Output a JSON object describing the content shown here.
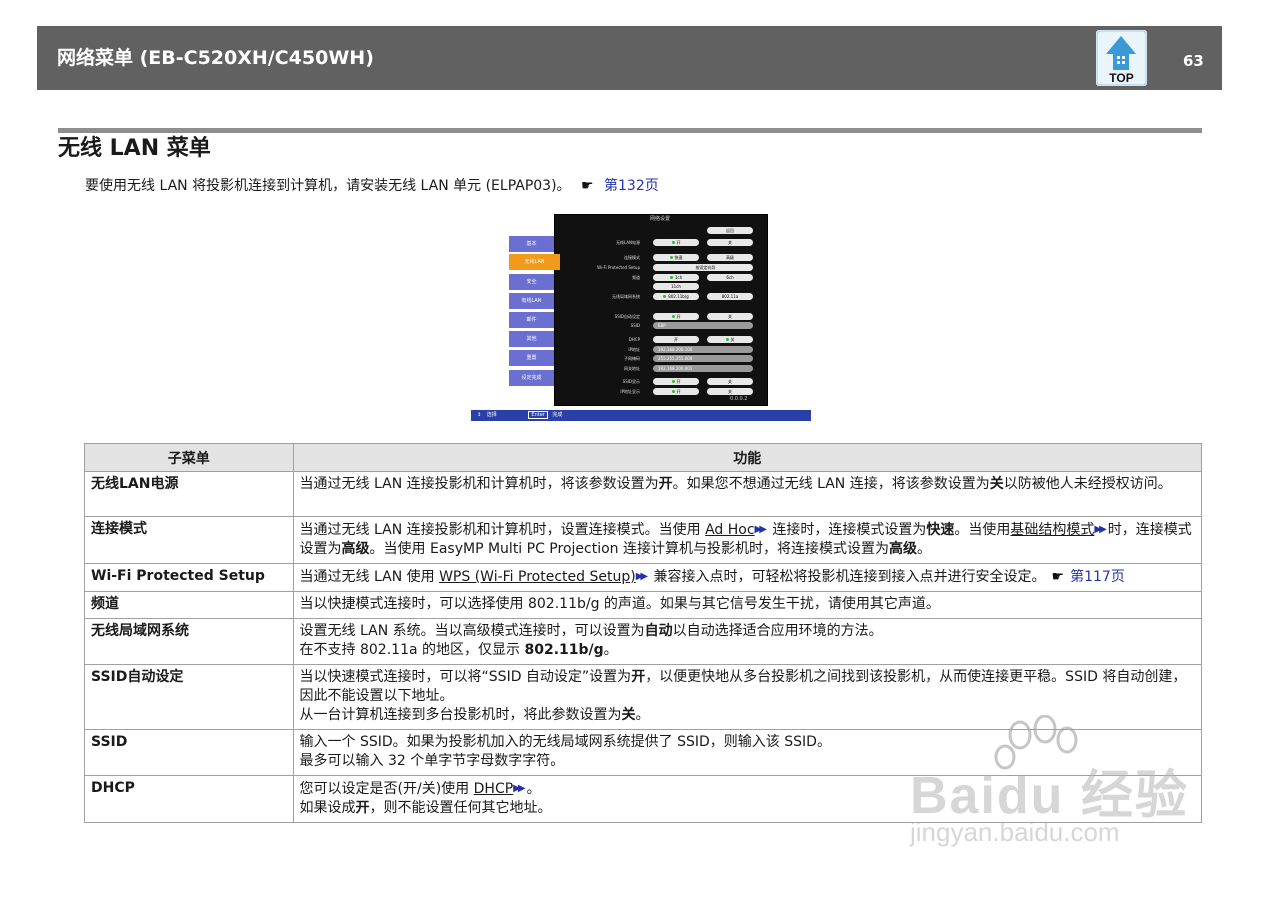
{
  "header": {
    "title": "网络菜单 (EB-C520XH/C450WH)",
    "top_label": "TOP",
    "page_number": "63"
  },
  "section": {
    "title": "无线 LAN 菜单"
  },
  "intro": {
    "text": "要使用无线 LAN 将投影机连接到计算机，请安装无线 LAN 单元 (ELPAP03)。",
    "link": "第132页"
  },
  "screenshot": {
    "title": "网络设置",
    "side_items": [
      "基本",
      "无线LAN",
      "安全",
      "有线LAN",
      "邮件",
      "其他",
      "重置",
      "设定完成"
    ],
    "back": "返回",
    "rows": [
      {
        "label": "无线LAN电源",
        "v1": "开",
        "v2": "关"
      },
      {
        "label": "连接模式",
        "v1": "快速",
        "v2": "高级"
      },
      {
        "label": "Wi-Fi Protected Setup",
        "v1": "按设定向导",
        "v2": ""
      },
      {
        "label": "频道",
        "v1": "1ch",
        "v2": "6ch"
      },
      {
        "label": "",
        "v1": "11ch",
        "v2": ""
      },
      {
        "label": "无线局域网系统",
        "v1": "802.11b/g",
        "v2": "802.11a"
      },
      {
        "label": "SSID自动设定",
        "v1": "开",
        "v2": "关"
      },
      {
        "label": "SSID",
        "v1": "EBP",
        "v2": ""
      },
      {
        "label": "DHCP",
        "v1": "开",
        "v2": "关"
      },
      {
        "label": "IP地址",
        "v1": "192.168.200.100",
        "v2": ""
      },
      {
        "label": "子网掩码",
        "v1": "255.255.255.000",
        "v2": ""
      },
      {
        "label": "网关地址",
        "v1": "192.168.200.001",
        "v2": ""
      },
      {
        "label": "SSID显示",
        "v1": "开",
        "v2": "关"
      },
      {
        "label": "IP地址显示",
        "v1": "开",
        "v2": "关"
      }
    ],
    "version": "0.0.0.2",
    "footer_select": "选择",
    "footer_enter": "Enter",
    "footer_enter_label": "完成"
  },
  "table": {
    "headers": [
      "子菜单",
      "功能"
    ],
    "rows": [
      {
        "sub": "无线LAN电源",
        "fn": [
          "当通过无线 LAN 连接投影机和计算机时，将该参数设置为",
          "开",
          "。如果您不想通过无线 LAN 连接，将该参数设置为",
          "关",
          "以防被他人未经授权访问。"
        ]
      },
      {
        "sub": "连接模式",
        "fn": [
          "当通过无线 LAN 连接投影机和计算机时，设置连接模式。当使用 ",
          "Ad Hoc",
          " 连接时，连接模式设置为",
          "快速",
          "。当使用",
          "基础结构模式",
          "时，连接模式设置为",
          "高级",
          "。当使用 EasyMP Multi PC Projection 连接计算机与投影机时，将连接模式设置为",
          "高级",
          "。"
        ]
      },
      {
        "sub": "Wi-Fi Protected Setup",
        "fn": [
          "当通过无线 LAN 使用 ",
          "WPS (Wi-Fi Protected Setup)",
          " 兼容接入点时，可轻松将投影机连接到接入点并进行安全设定。",
          "第117页"
        ]
      },
      {
        "sub": "频道",
        "fn": [
          "当以快捷模式连接时，可以选择使用 802.11b/g 的声道。如果与其它信号发生干扰，请使用其它声道。"
        ]
      },
      {
        "sub": "无线局域网系统",
        "fn": [
          "设置无线 LAN 系统。当以高级模式连接时，可以设置为",
          "自动",
          "以自动选择适合应用环境的方法。",
          "在不支持 802.11a 的地区，仅显示 ",
          "802.11b/g",
          "。"
        ]
      },
      {
        "sub": "SSID自动设定",
        "fn": [
          "当以快速模式连接时，可以将“SSID 自动设定”设置为",
          "开",
          "，以便更快地从多台投影机之间找到该投影机，从而使连接更平稳。SSID 将自动创建，因此不能设置以下地址。",
          "从一台计算机连接到多台投影机时，将此参数设置为",
          "关",
          "。"
        ]
      },
      {
        "sub": "SSID",
        "fn": [
          "输入一个 SSID。如果为投影机加入的无线局域网系统提供了 SSID，则输入该 SSID。",
          "最多可以输入 32 个单字节字母数字字符。"
        ]
      },
      {
        "sub": "DHCP",
        "fn": [
          "您可以设定是否(开/关)使用 ",
          "DHCP",
          "。",
          "如果设成",
          "开",
          "，则不能设置任何其它地址。"
        ]
      }
    ]
  },
  "watermark": {
    "brand": "Baidu 经验",
    "url": "jingyan.baidu.com"
  }
}
